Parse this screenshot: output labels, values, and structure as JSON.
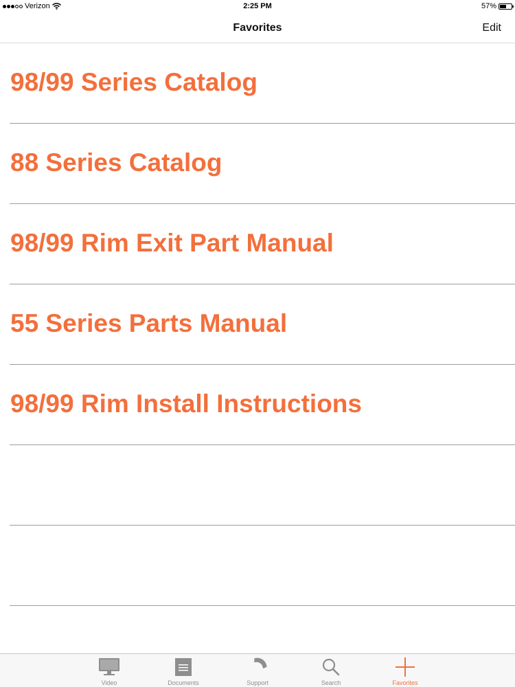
{
  "status_bar": {
    "carrier": "Verizon",
    "time": "2:25 PM",
    "battery_percent": "57%",
    "battery_level": 0.57
  },
  "nav": {
    "title": "Favorites",
    "edit_label": "Edit"
  },
  "colors": {
    "accent": "#f36f3c",
    "separator": "#9c9c9c",
    "tab_inactive": "#8e8e8e"
  },
  "favorites": [
    {
      "label": "98/99 Series Catalog"
    },
    {
      "label": "88 Series Catalog"
    },
    {
      "label": "98/99 Rim Exit Part Manual"
    },
    {
      "label": "55 Series Parts Manual"
    },
    {
      "label": "98/99 Rim Install Instructions"
    },
    {
      "label": ""
    },
    {
      "label": ""
    }
  ],
  "tabs": [
    {
      "label": "Video",
      "icon": "monitor-icon",
      "active": false
    },
    {
      "label": "Documents",
      "icon": "document-icon",
      "active": false
    },
    {
      "label": "Support",
      "icon": "phone-icon",
      "active": false
    },
    {
      "label": "Search",
      "icon": "search-icon",
      "active": false
    },
    {
      "label": "Favorites",
      "icon": "plus-icon",
      "active": true
    }
  ]
}
